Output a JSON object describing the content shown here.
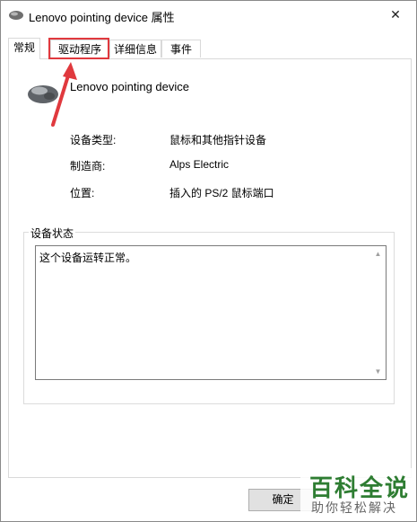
{
  "window": {
    "title": "Lenovo pointing device 属性",
    "close_glyph": "✕"
  },
  "tabs": [
    {
      "label": "常规",
      "active": true
    },
    {
      "label": "驱动程序",
      "active": false
    },
    {
      "label": "详细信息",
      "active": false
    },
    {
      "label": "事件",
      "active": false
    }
  ],
  "device": {
    "name": "Lenovo pointing device",
    "icon": "mouse-icon"
  },
  "properties": [
    {
      "label": "设备类型:",
      "value": "鼠标和其他指针设备"
    },
    {
      "label": "制造商:",
      "value": "Alps Electric"
    },
    {
      "label": "位置:",
      "value": "插入的 PS/2 鼠标端口"
    }
  ],
  "status": {
    "legend": "设备状态",
    "text": "这个设备运转正常。"
  },
  "buttons": {
    "ok_label": "确定"
  },
  "annotation": {
    "color": "#e0393e",
    "highlighted_tab": "驱动程序"
  },
  "watermark": {
    "title": "百科全说",
    "subtitle": "助你轻松解决",
    "title_color": "#2e7d32"
  }
}
